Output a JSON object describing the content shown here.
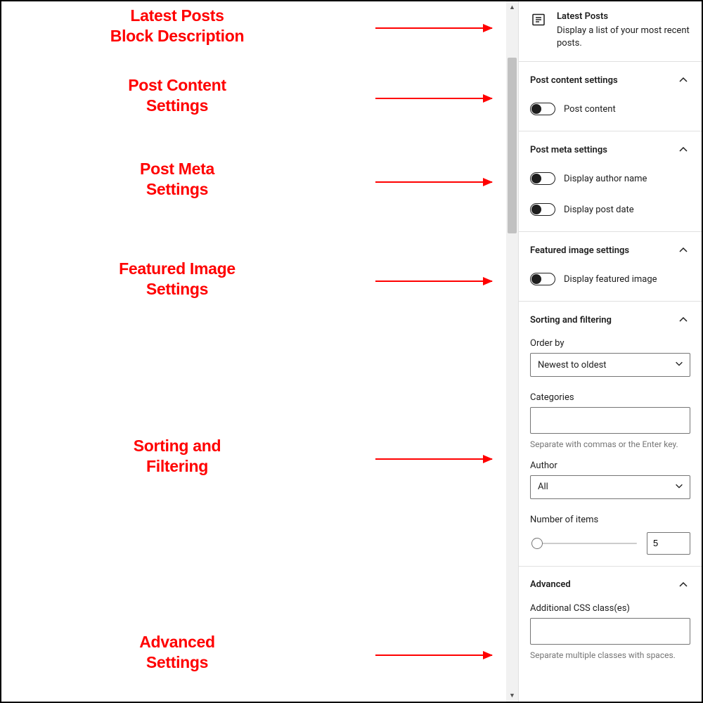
{
  "annotations": {
    "block_desc": {
      "line1": "Latest Posts",
      "line2": "Block Description"
    },
    "post_content": {
      "line1": "Post Content Settings",
      "line2": ""
    },
    "post_content_a": {
      "line1": "Post Content",
      "line2": "Settings"
    },
    "post_meta": {
      "line1": "Post Meta",
      "line2": "Settings"
    },
    "featured": {
      "line1": "Featured Image",
      "line2": "Settings"
    },
    "sorting": {
      "line1": "Sorting and",
      "line2": "Filtering"
    },
    "advanced": {
      "line1": "Advanced",
      "line2": "Settings"
    }
  },
  "block": {
    "title": "Latest Posts",
    "description": "Display a list of your most recent posts."
  },
  "panels": {
    "post_content": {
      "title": "Post content settings",
      "toggle_label": "Post content"
    },
    "post_meta": {
      "title": "Post meta settings",
      "author_label": "Display author name",
      "date_label": "Display post date"
    },
    "featured": {
      "title": "Featured image settings",
      "toggle_label": "Display featured image"
    },
    "sorting": {
      "title": "Sorting and filtering",
      "order_by_label": "Order by",
      "order_by_value": "Newest to oldest",
      "categories_label": "Categories",
      "categories_help": "Separate with commas or the Enter key.",
      "author_label": "Author",
      "author_value": "All",
      "items_label": "Number of items",
      "items_value": "5"
    },
    "advanced": {
      "title": "Advanced",
      "css_label": "Additional CSS class(es)",
      "css_help": "Separate multiple classes with spaces."
    }
  }
}
